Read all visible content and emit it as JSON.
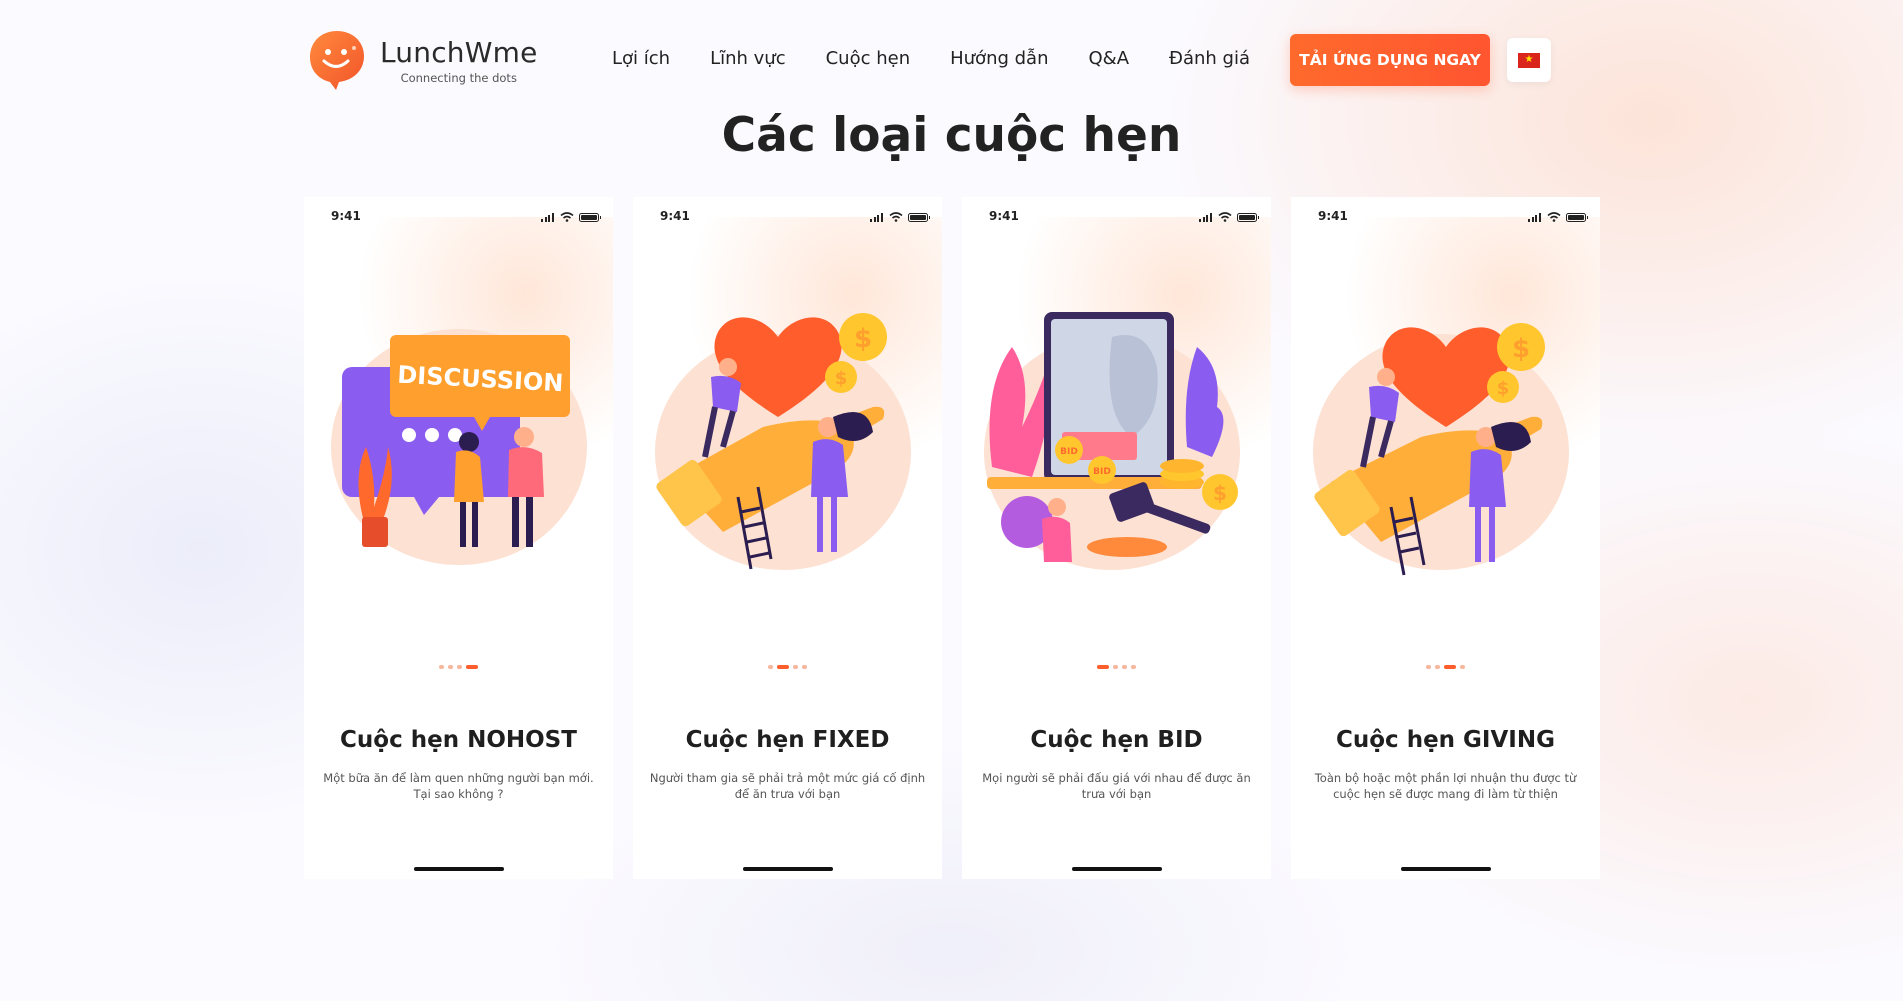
{
  "brand": {
    "name": "LunchWme",
    "tagline": "Connecting the dots"
  },
  "nav": {
    "items": [
      {
        "label": "Lợi ích"
      },
      {
        "label": "Lĩnh vực"
      },
      {
        "label": "Cuộc hẹn"
      },
      {
        "label": "Hướng dẫn"
      },
      {
        "label": "Q&A"
      },
      {
        "label": "Đánh giá"
      }
    ]
  },
  "cta": {
    "label": "TẢI ỨNG DỤNG NGAY"
  },
  "language": {
    "flag_icon": "vietnam-flag-icon"
  },
  "section": {
    "title": "Các loại cuộc hẹn"
  },
  "colors": {
    "accent": "#ff5e2c",
    "card_bg": "#ffffff",
    "text": "#222222"
  },
  "cards": [
    {
      "time": "9:41",
      "illustration": "discussion-illustration",
      "badge_text": "DISCUSSION",
      "active_dot": 3,
      "title": "Cuộc hẹn NOHOST",
      "description": "Một bữa ăn để làm quen những người bạn mới. Tại sao không ?"
    },
    {
      "time": "9:41",
      "illustration": "heart-coins-illustration",
      "active_dot": 1,
      "title": "Cuộc hẹn FIXED",
      "description": "Người tham gia sẽ phải trả một mức giá cố định để ăn trưa với bạn"
    },
    {
      "time": "9:41",
      "illustration": "auction-bid-illustration",
      "bid_labels": [
        "BID",
        "BID"
      ],
      "active_dot": 0,
      "title": "Cuộc hẹn BID",
      "description": "Mọi người sẽ phải đấu giá với nhau để được ăn trưa với bạn"
    },
    {
      "time": "9:41",
      "illustration": "heart-coins-illustration",
      "active_dot": 2,
      "title": "Cuộc hẹn GIVING",
      "description": "Toàn bộ hoặc một phần lợi nhuận thu được từ cuộc hẹn sẽ được mang đi làm từ thiện"
    }
  ]
}
